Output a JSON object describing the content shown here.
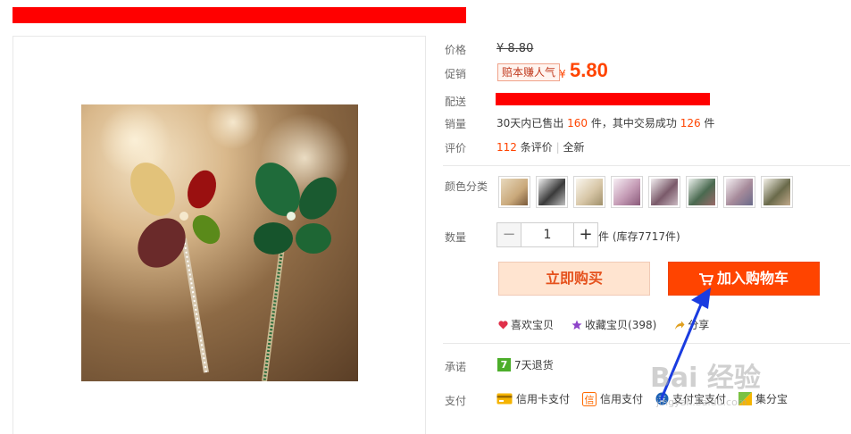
{
  "labels": {
    "price": "价格",
    "promo": "促销",
    "shipping": "配送",
    "sales": "销量",
    "reviews": "评价",
    "color": "颜色分类",
    "quantity": "数量",
    "promise": "承诺",
    "payment": "支付"
  },
  "price": {
    "original": "¥ 8.80",
    "promo_tag": "赔本赚人气",
    "currency": "¥",
    "promo_price": "5.80"
  },
  "sales": {
    "prefix": "30天内已售出",
    "sold": "160",
    "mid": "件，其中交易成功",
    "success": "126",
    "suffix": "件"
  },
  "reviews": {
    "count": "112",
    "count_suffix": "条评价",
    "link": "全新"
  },
  "quantity": {
    "minus": "−",
    "value": "1",
    "plus": "+",
    "unit_stock": "件 (库存7717件)"
  },
  "actions": {
    "buy_now": "立即购买",
    "add_to_cart": "加入购物车"
  },
  "social": {
    "like": "喜欢宝贝",
    "favorite": "收藏宝贝(398)",
    "share": "分享"
  },
  "promise": {
    "badge": "7",
    "text": "7天退货"
  },
  "payments": [
    {
      "label": "信用卡支付",
      "icon": "credit-card-icon"
    },
    {
      "label": "信用支付",
      "icon": "credit-pay-icon"
    },
    {
      "label": "支付宝支付",
      "icon": "alipay-icon"
    },
    {
      "label": "集分宝",
      "icon": "jifenbao-icon"
    }
  ],
  "swatches": [
    {
      "color": "#c9a87a"
    },
    {
      "color": "#3a3a3a"
    },
    {
      "color": "#d8c7a8"
    },
    {
      "color": "#c49bb5"
    },
    {
      "color": "#7a5a6a"
    },
    {
      "color": "#4a6a50"
    },
    {
      "color": "#a68a9a"
    },
    {
      "color": "#6a6a4a"
    }
  ],
  "watermark": {
    "main": "Bai 经验",
    "sub": "jingyan.baidu.com"
  },
  "colors": {
    "accent": "#ff4400",
    "buy_now_bg": "#ffe4d0",
    "redaction": "#ff0000",
    "arrow": "#1a3ce0"
  }
}
